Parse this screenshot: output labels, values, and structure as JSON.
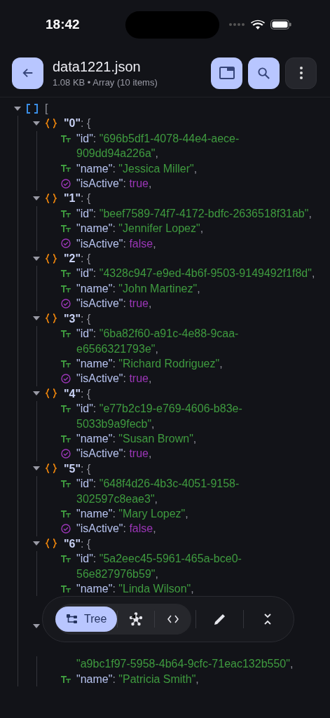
{
  "status_bar": {
    "time": "18:42"
  },
  "header": {
    "title": "data1221.json",
    "subtitle": "1.08 KB • Array (10 items)"
  },
  "tree": {
    "expanded": true,
    "open": "[",
    "items": [
      {
        "expanded": true,
        "key": "\"0\":",
        "open": "{",
        "fields": [
          {
            "kind": "string",
            "key": "\"id\":",
            "value": "\"696b5df1-4078-44e4-aece-909dd94a226a\","
          },
          {
            "kind": "string",
            "key": "\"name\":",
            "value": "\"Jessica Miller\","
          },
          {
            "kind": "boolean",
            "key": "\"isActive\":",
            "value": "true,"
          }
        ]
      },
      {
        "expanded": true,
        "key": "\"1\":",
        "open": "{",
        "fields": [
          {
            "kind": "string",
            "key": "\"id\":",
            "value": "\"beef7589-74f7-4172-bdfc-2636518f31ab\","
          },
          {
            "kind": "string",
            "key": "\"name\":",
            "value": "\"Jennifer Lopez\","
          },
          {
            "kind": "boolean",
            "key": "\"isActive\":",
            "value": "false,"
          }
        ]
      },
      {
        "expanded": true,
        "key": "\"2\":",
        "open": "{",
        "fields": [
          {
            "kind": "string",
            "key": "\"id\":",
            "value": "\"4328c947-e9ed-4b6f-9503-9149492f1f8d\","
          },
          {
            "kind": "string",
            "key": "\"name\":",
            "value": "\"John Martinez\","
          },
          {
            "kind": "boolean",
            "key": "\"isActive\":",
            "value": "true,"
          }
        ]
      },
      {
        "expanded": true,
        "key": "\"3\":",
        "open": "{",
        "fields": [
          {
            "kind": "string",
            "key": "\"id\":",
            "value": "\"6ba82f60-a91c-4e88-9caa-e6566321793e\","
          },
          {
            "kind": "string",
            "key": "\"name\":",
            "value": "\"Richard Rodriguez\","
          },
          {
            "kind": "boolean",
            "key": "\"isActive\":",
            "value": "true,"
          }
        ]
      },
      {
        "expanded": true,
        "key": "\"4\":",
        "open": "{",
        "fields": [
          {
            "kind": "string",
            "key": "\"id\":",
            "value": "\"e77b2c19-e769-4606-b83e-5033b9a9fecb\","
          },
          {
            "kind": "string",
            "key": "\"name\":",
            "value": "\"Susan Brown\","
          },
          {
            "kind": "boolean",
            "key": "\"isActive\":",
            "value": "true,"
          }
        ]
      },
      {
        "expanded": true,
        "key": "\"5\":",
        "open": "{",
        "fields": [
          {
            "kind": "string",
            "key": "\"id\":",
            "value": "\"648f4d26-4b3c-4051-9158-302597c8eae3\","
          },
          {
            "kind": "string",
            "key": "\"name\":",
            "value": "\"Mary Lopez\","
          },
          {
            "kind": "boolean",
            "key": "\"isActive\":",
            "value": "false,"
          }
        ]
      },
      {
        "expanded": true,
        "key": "\"6\":",
        "open": "{",
        "fields": [
          {
            "kind": "string",
            "key": "\"id\":",
            "value": "\"5a2eec45-5961-465a-bce0-56e827976b59\","
          },
          {
            "kind": "string",
            "key": "\"name\":",
            "value": "\"Linda Wilson\","
          }
        ]
      },
      {
        "expanded": true,
        "fields": [
          {
            "kind": "string",
            "value": "\"a9bc1f97-5958-4b64-9cfc-71eac132b550\","
          },
          {
            "kind": "string",
            "key": "\"name\":",
            "value": "\"Patricia Smith\","
          }
        ]
      }
    ]
  },
  "toolbar": {
    "views": [
      {
        "kind": "tree",
        "label": "Tree",
        "selected": true
      },
      {
        "kind": "graph",
        "selected": false
      },
      {
        "kind": "code",
        "selected": false
      }
    ],
    "actions": [
      {
        "kind": "edit"
      },
      {
        "kind": "collapse"
      }
    ]
  }
}
